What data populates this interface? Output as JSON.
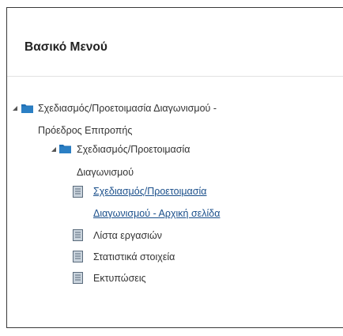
{
  "panel": {
    "title": "Βασικό Μενού"
  },
  "tree": {
    "root": {
      "label_line1": "Σχεδιασμός/Προετοιμασία Διαγωνισμού -",
      "label_line2": "Πρόεδρος Επιτροπής",
      "icon": "folder-icon",
      "expanded": true
    },
    "child": {
      "label_line1": "Σχεδιασμός/Προετοιμασία",
      "label_line2": "Διαγωνισμού",
      "icon": "folder-icon",
      "expanded": true
    },
    "items": [
      {
        "label_line1": "Σχεδιασμός/Προετοιμασία",
        "label_line2": "Διαγωνισμού - Αρχική σελίδα",
        "icon": "document-icon",
        "link": true
      },
      {
        "label_line1": "Λίστα εργασιών",
        "icon": "document-icon",
        "link": false
      },
      {
        "label_line1": "Στατιστικά στοιχεία",
        "icon": "document-icon",
        "link": false
      },
      {
        "label_line1": "Εκτυπώσεις",
        "icon": "document-icon",
        "link": false
      }
    ]
  },
  "colors": {
    "folder": "#1f6fb4",
    "link": "#1a4f8b",
    "text": "#333333",
    "doc_border": "#5a6b7c",
    "doc_fill": "#c9d3dc"
  }
}
